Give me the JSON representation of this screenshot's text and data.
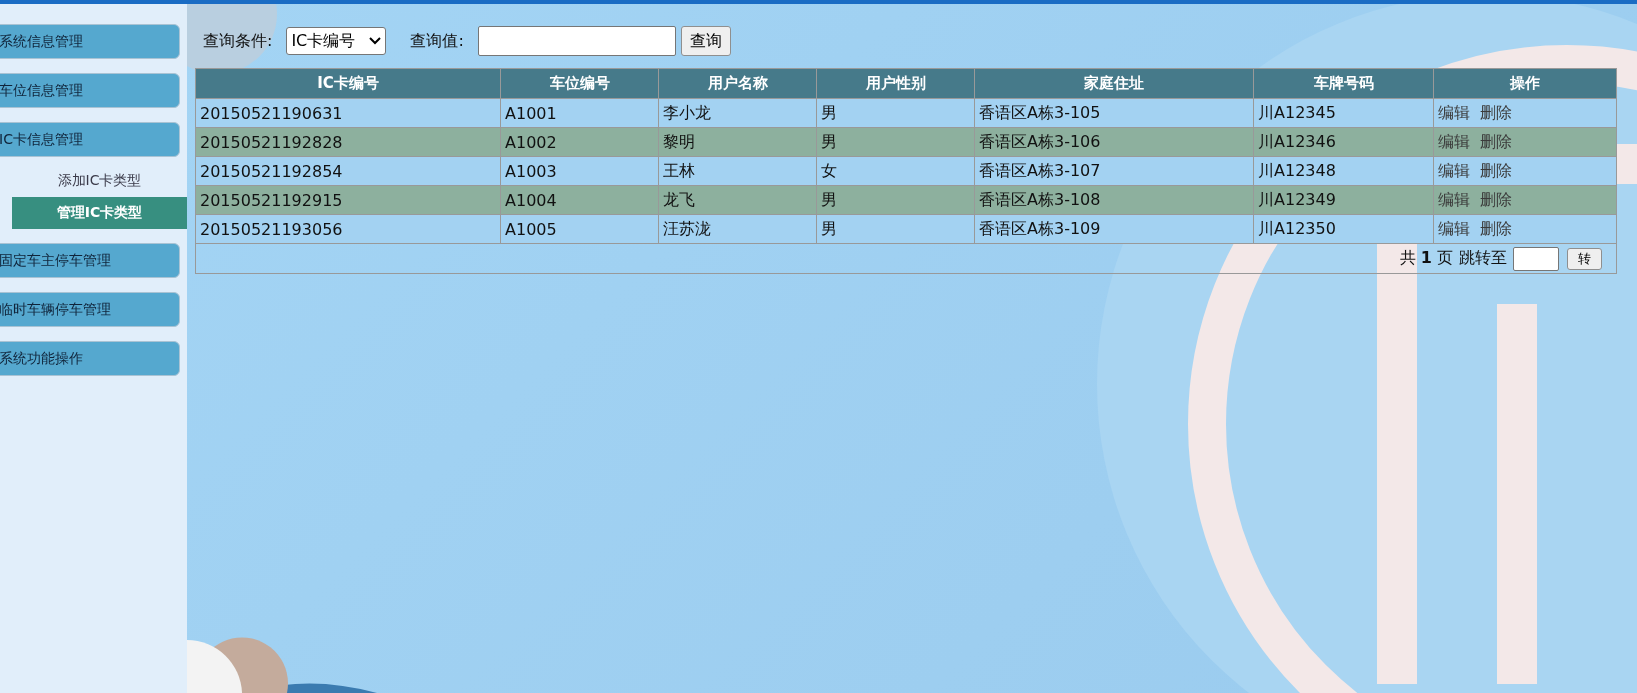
{
  "sidebar": {
    "items": [
      {
        "label": "系统信息管理"
      },
      {
        "label": "车位信息管理"
      },
      {
        "label": "IC卡信息管理",
        "children": [
          {
            "label": "添加IC卡类型",
            "selected": false
          },
          {
            "label": "管理IC卡类型",
            "selected": true
          }
        ]
      },
      {
        "label": "固定车主停车管理"
      },
      {
        "label": "临时车辆停车管理"
      },
      {
        "label": "系统功能操作"
      }
    ]
  },
  "search": {
    "condition_label": "查询条件:",
    "condition_value": "IC卡编号",
    "value_label": "查询值:",
    "button": "查询"
  },
  "table": {
    "columns": [
      "IC卡编号",
      "车位编号",
      "用户名称",
      "用户性别",
      "家庭住址",
      "车牌号码",
      "操作"
    ],
    "rows": [
      {
        "cells": [
          "20150521190631",
          "A1001",
          "李小龙",
          "男",
          "香语区A栋3-105",
          "川A12345"
        ],
        "actions": [
          "编辑",
          "删除"
        ]
      },
      {
        "cells": [
          "20150521192828",
          "A1002",
          "黎明",
          "男",
          "香语区A栋3-106",
          "川A12346"
        ],
        "actions": [
          "编辑",
          "删除"
        ]
      },
      {
        "cells": [
          "20150521192854",
          "A1003",
          "王林",
          "女",
          "香语区A栋3-107",
          "川A12348"
        ],
        "actions": [
          "编辑",
          "删除"
        ]
      },
      {
        "cells": [
          "20150521192915",
          "A1004",
          "龙飞",
          "男",
          "香语区A栋3-108",
          "川A12349"
        ],
        "actions": [
          "编辑",
          "删除"
        ]
      },
      {
        "cells": [
          "20150521193056",
          "A1005",
          "汪苏泷",
          "男",
          "香语区A栋3-109",
          "川A12350"
        ],
        "actions": [
          "编辑",
          "删除"
        ]
      }
    ]
  },
  "pager": {
    "total_prefix": "共",
    "total": "1",
    "total_suffix": "页",
    "jump_label": "跳转至",
    "button": "转"
  }
}
